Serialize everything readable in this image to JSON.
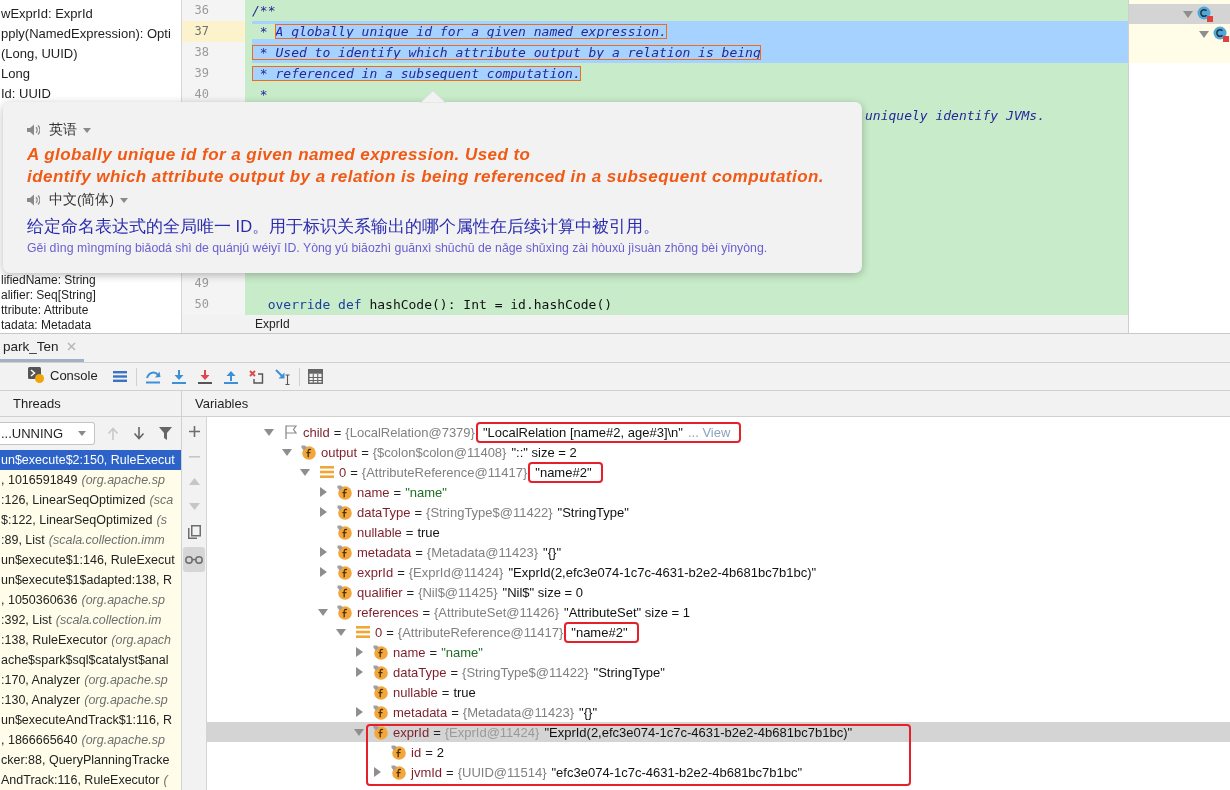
{
  "structure_panel": {
    "top_items": [
      "wExprId: ExprId",
      "pply(NamedExpression): Opti",
      "(Long, UUID)",
      "Long",
      "Id: UUID"
    ],
    "bottom_items": [
      "lifiedName: String",
      "alifier: Seq[String]",
      "ttribute: Attribute",
      "tadata: Metadata"
    ]
  },
  "editor": {
    "top_lines": [
      {
        "kind": "numbered",
        "number": "36",
        "current": false,
        "selected_to_end": false,
        "tokens": [
          {
            "text": "/**",
            "kind": "doc",
            "selected": false
          }
        ]
      },
      {
        "kind": "numbered",
        "number": "37",
        "current": true,
        "selected_to_end": true,
        "tokens": [
          {
            "text": " * ",
            "kind": "doc",
            "selected": false
          },
          {
            "text": "A globally unique id for a given named expression.",
            "kind": "doc",
            "selected": true
          }
        ]
      },
      {
        "kind": "numbered",
        "number": "38",
        "current": false,
        "selected_to_end": true,
        "tokens": [
          {
            "text": " * Used to identify which attribute output by a relation is being",
            "kind": "doc",
            "selected": true
          }
        ]
      },
      {
        "kind": "numbered",
        "number": "39",
        "current": false,
        "selected_to_end": false,
        "tokens": [
          {
            "text": " * referenced in a subsequent computation.",
            "kind": "doc",
            "selected": true
          }
        ]
      },
      {
        "kind": "numbered",
        "number": "40",
        "current": false,
        "selected_to_end": false,
        "tokens": [
          {
            "text": " *",
            "kind": "doc",
            "selected": false
          }
        ]
      },
      {
        "kind": "fragment",
        "current": false,
        "selected_to_end": false,
        "tokens": [
          {
            "text": "uniquely identify JVMs.",
            "kind": "doc",
            "selected": false
          }
        ]
      }
    ],
    "bottom_lines": [
      {
        "kind": "numbered",
        "number": "49",
        "current": false,
        "selected_to_end": false
      },
      {
        "kind": "numbered",
        "number": "50",
        "current": false,
        "selected_to_end": false,
        "tokens": [
          {
            "text": "  override def",
            "kind": "keyword",
            "selected": false
          },
          {
            "text": " hashCode(): Int = id.hashCode()",
            "kind": "plain",
            "selected": false
          }
        ]
      }
    ],
    "selection_outlined": true,
    "breadcrumb": "ExprId"
  },
  "translation_popup": {
    "source": {
      "language": "英语",
      "lines": [
        "A globally unique id for a given named expression. Used to",
        "identify which attribute output by a relation is being referenced in a subsequent computation."
      ]
    },
    "target": {
      "language": "中文(简体)",
      "text": "给定命名表达式的全局唯一 ID。用于标识关系输出的哪个属性在后续计算中被引用。",
      "pinyin": "Gěi dìng mìngmíng biǎodá shì de quánjú wéiyī ID. Yòng yú biāozhì guānxì shūchū de nǎge shǔxìng zài hòuxù jìsuàn zhōng bèi yǐnyòng."
    }
  },
  "outline_panel": {
    "nodes": [
      {
        "expanded": true,
        "selected": true,
        "children": [
          {
            "expanded": true,
            "selected": false
          }
        ]
      }
    ]
  },
  "debugger": {
    "session_tabs": [
      {
        "label": "park_Ten",
        "selected": true,
        "closable": true
      }
    ],
    "toolbar": {
      "tabs": [
        {
          "label": "Console",
          "selected": false
        }
      ],
      "button_groups": [
        [
          {
            "kind": "menu"
          }
        ],
        [
          {
            "kind": "step_over"
          },
          {
            "kind": "step_into"
          },
          {
            "kind": "force_step_into"
          },
          {
            "kind": "step_out"
          },
          {
            "kind": "drop_frame"
          },
          {
            "kind": "run_to_cursor"
          }
        ],
        [
          {
            "kind": "evaluate"
          }
        ]
      ]
    },
    "frames_panel": {
      "title": "Threads",
      "thread": "...UNNING",
      "buttons": [
        {
          "kind": "previous",
          "disabled": true
        },
        {
          "kind": "next",
          "disabled": false
        },
        {
          "kind": "filter",
          "disabled": false
        }
      ],
      "frames": [
        {
          "method": "un$execute$2:150, RuleExecut",
          "selected": true
        },
        {
          "method": ", 1016591849",
          "location": "(org.apache.sp",
          "selected": false
        },
        {
          "method": ":126, LinearSeqOptimized",
          "location": "(sca",
          "selected": false
        },
        {
          "method": "$:122, LinearSeqOptimized",
          "location": "(s",
          "selected": false
        },
        {
          "method": ":89, List",
          "location": "(scala.collection.imm",
          "selected": false
        },
        {
          "method": "un$execute$1:146, RuleExecut",
          "selected": false
        },
        {
          "method": "un$execute$1$adapted:138, R",
          "selected": false
        },
        {
          "method": ", 1050360636",
          "location": "(org.apache.sp",
          "selected": false
        },
        {
          "method": ":392, List",
          "location": "(scala.collection.im",
          "selected": false
        },
        {
          "method": ":138, RuleExecutor",
          "location": "(org.apach",
          "selected": false
        },
        {
          "method": "ache$spark$sql$catalyst$anal",
          "selected": false
        },
        {
          "method": ":170, Analyzer",
          "location": "(org.apache.sp",
          "selected": false
        },
        {
          "method": ":130, Analyzer",
          "location": "(org.apache.sp",
          "selected": false
        },
        {
          "method": "un$executeAndTrack$1:116, R",
          "selected": false
        },
        {
          "method": ", 1866665640",
          "location": "(org.apache.sp",
          "selected": false
        },
        {
          "method": "cker:88, QueryPlanningTracke",
          "selected": false
        },
        {
          "method": "AndTrack:116, RuleExecutor",
          "location": "(",
          "selected": false
        }
      ]
    },
    "variables_panel": {
      "title": "Variables",
      "side_buttons": [
        {
          "kind": "add",
          "disabled": false,
          "on": false
        },
        {
          "kind": "remove",
          "disabled": true,
          "on": false
        },
        {
          "kind": "move_up",
          "disabled": true,
          "on": false
        },
        {
          "kind": "move_down",
          "disabled": true,
          "on": false
        },
        {
          "kind": "duplicate",
          "disabled": false,
          "on": false
        },
        {
          "kind": "watches",
          "disabled": false,
          "on": true
        }
      ],
      "tree": [
        {
          "kind": "flag",
          "name": "child",
          "op": "=",
          "ref": "{LocalRelation@7379}",
          "value": {
            "text": "\"LocalRelation [name#2, age#3]\\n\"",
            "kind": "plain",
            "boxed": true
          },
          "link": "... View",
          "expanded": true,
          "selected": false,
          "children": [
            {
              "kind": "field",
              "name": "output",
              "op": "=",
              "ref": "{$colon$colon@11408}",
              "value": {
                "text": "\"::\" size = 2",
                "kind": "plain"
              },
              "expanded": true,
              "selected": false,
              "children": [
                {
                  "kind": "element",
                  "name": "0",
                  "op": "=",
                  "ref": "{AttributeReference@11417}",
                  "value": {
                    "text": "\"name#2\"",
                    "kind": "plain",
                    "boxed": true
                  },
                  "expanded": true,
                  "selected": false,
                  "children": [
                    {
                      "kind": "field",
                      "name": "name",
                      "op": "=",
                      "value": {
                        "text": "\"name\"",
                        "kind": "string"
                      },
                      "expanded": false,
                      "selected": false
                    },
                    {
                      "kind": "field",
                      "name": "dataType",
                      "op": "=",
                      "ref": "{StringType$@11422}",
                      "value": {
                        "text": "\"StringType\"",
                        "kind": "plain"
                      },
                      "expanded": false,
                      "selected": false
                    },
                    {
                      "kind": "field",
                      "name": "nullable",
                      "op": "=",
                      "value": {
                        "text": "true",
                        "kind": "plain"
                      },
                      "selected": false
                    },
                    {
                      "kind": "field",
                      "name": "metadata",
                      "op": "=",
                      "ref": "{Metadata@11423}",
                      "value": {
                        "text": "\"{}\"",
                        "kind": "plain"
                      },
                      "expanded": false,
                      "selected": false
                    },
                    {
                      "kind": "field",
                      "name": "exprId",
                      "op": "=",
                      "ref": "{ExprId@11424}",
                      "value": {
                        "text": "\"ExprId(2,efc3e074-1c7c-4631-b2e2-4b681bc7b1bc)\"",
                        "kind": "plain"
                      },
                      "expanded": false,
                      "selected": false
                    },
                    {
                      "kind": "field",
                      "name": "qualifier",
                      "op": "=",
                      "ref": "{Nil$@11425}",
                      "value": {
                        "text": "\"Nil$\" size = 0",
                        "kind": "plain"
                      },
                      "selected": false
                    },
                    {
                      "kind": "field",
                      "name": "references",
                      "op": "=",
                      "ref": "{AttributeSet@11426}",
                      "value": {
                        "text": "\"AttributeSet\" size = 1",
                        "kind": "plain"
                      },
                      "expanded": true,
                      "selected": false,
                      "children": [
                        {
                          "kind": "element",
                          "name": "0",
                          "op": "=",
                          "ref": "{AttributeReference@11417}",
                          "value": {
                            "text": "\"name#2\"",
                            "kind": "plain",
                            "boxed": true
                          },
                          "expanded": true,
                          "selected": false,
                          "children": [
                            {
                              "kind": "field",
                              "name": "name",
                              "op": "=",
                              "value": {
                                "text": "\"name\"",
                                "kind": "string"
                              },
                              "expanded": false,
                              "selected": false
                            },
                            {
                              "kind": "field",
                              "name": "dataType",
                              "op": "=",
                              "ref": "{StringType$@11422}",
                              "value": {
                                "text": "\"StringType\"",
                                "kind": "plain"
                              },
                              "expanded": false,
                              "selected": false
                            },
                            {
                              "kind": "field",
                              "name": "nullable",
                              "op": "=",
                              "value": {
                                "text": "true",
                                "kind": "plain"
                              },
                              "selected": false
                            },
                            {
                              "kind": "field",
                              "name": "metadata",
                              "op": "=",
                              "ref": "{Metadata@11423}",
                              "value": {
                                "text": "\"{}\"",
                                "kind": "plain"
                              },
                              "expanded": false,
                              "selected": false
                            },
                            {
                              "kind": "field",
                              "name": "exprId",
                              "op": "=",
                              "ref": "{ExprId@11424}",
                              "value": {
                                "text": "\"ExprId(2,efc3e074-1c7c-4631-b2e2-4b681bc7b1bc)\"",
                                "kind": "plain"
                              },
                              "group_boxed": true,
                              "expanded": true,
                              "selected": true,
                              "children": [
                                {
                                  "kind": "field",
                                  "name": "id",
                                  "op": "=",
                                  "value": {
                                    "text": "2",
                                    "kind": "plain"
                                  },
                                  "selected": false
                                },
                                {
                                  "kind": "field",
                                  "name": "jvmId",
                                  "op": "=",
                                  "ref": "{UUID@11514}",
                                  "value": {
                                    "text": "\"efc3e074-1c7c-4631-b2e2-4b681bc7b1bc\"",
                                    "kind": "plain"
                                  },
                                  "expanded": false,
                                  "selected": false
                                }
                              ]
                            }
                          ]
                        }
                      ]
                    }
                  ]
                }
              ]
            }
          ]
        }
      ]
    }
  }
}
